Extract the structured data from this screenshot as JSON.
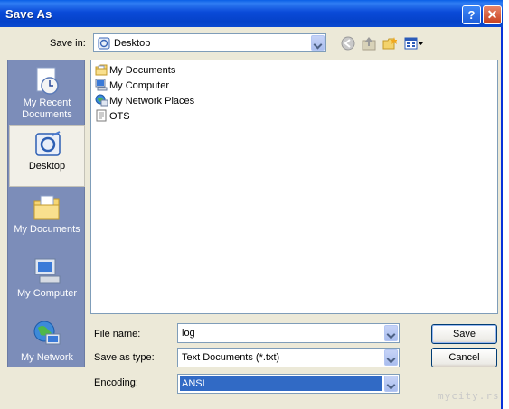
{
  "window": {
    "title": "Save As",
    "help_label": "?",
    "close_label": "✕"
  },
  "save_in": {
    "label": "Save in:",
    "value": "Desktop"
  },
  "toolbar": {
    "icons": [
      "back-icon",
      "up-folder-icon",
      "new-folder-icon",
      "views-menu-icon"
    ]
  },
  "places": [
    {
      "label": "My Recent Documents",
      "icon": "recent-documents-icon",
      "selected": false
    },
    {
      "label": "Desktop",
      "icon": "desktop-icon",
      "selected": true
    },
    {
      "label": "My Documents",
      "icon": "my-documents-icon",
      "selected": false
    },
    {
      "label": "My Computer",
      "icon": "my-computer-icon",
      "selected": false
    },
    {
      "label": "My Network",
      "icon": "my-network-icon",
      "selected": false
    }
  ],
  "files": [
    {
      "name": "My Documents",
      "icon": "folder-icon"
    },
    {
      "name": "My Computer",
      "icon": "computer-icon"
    },
    {
      "name": "My Network Places",
      "icon": "network-places-icon"
    },
    {
      "name": "OTS",
      "icon": "text-file-icon"
    }
  ],
  "form": {
    "file_name": {
      "label": "File name:",
      "value": "log"
    },
    "save_as_type": {
      "label": "Save as type:",
      "value": "Text Documents (*.txt)"
    },
    "encoding": {
      "label": "Encoding:",
      "value": "ANSI"
    }
  },
  "buttons": {
    "save": "Save",
    "cancel": "Cancel"
  },
  "watermark": "mycity.rs"
}
